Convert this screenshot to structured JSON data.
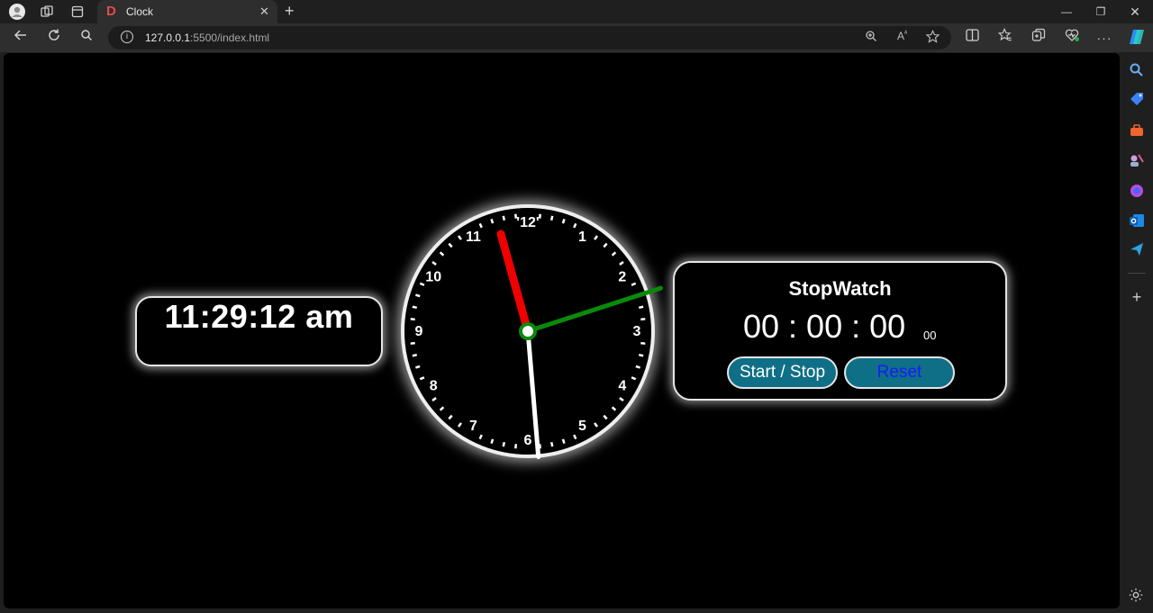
{
  "browser": {
    "tab_title": "Clock",
    "tab_favicon": "D",
    "url_host": "127.0.0.1",
    "url_path": ":5500/index.html"
  },
  "icons": {
    "profile": "avatar-icon",
    "workspaces": "workspaces-icon",
    "tab_actions": "tab-actions-icon",
    "close": "close-icon",
    "new_tab": "plus-icon",
    "back": "arrow-left-icon",
    "refresh": "refresh-icon",
    "search": "search-icon",
    "info": "info-icon",
    "zoom": "zoom-icon",
    "read_aloud": "read-aloud-icon",
    "favorite": "star-icon",
    "split": "split-screen-icon",
    "favorites": "favorites-icon",
    "collections": "collections-icon",
    "health": "browser-essentials-icon",
    "more": "more-icon",
    "copilot": "copilot-icon",
    "settings": "gear-icon"
  },
  "digital_clock": {
    "time": "11:29:12 am"
  },
  "analog_clock": {
    "numerals": [
      "'12'",
      "1",
      "2",
      "3",
      "4",
      "5",
      "6",
      "7",
      "8",
      "9",
      "10",
      "11"
    ],
    "hour": 11,
    "minute": 29,
    "second": 12,
    "hour_hand_color": "#ee0000",
    "minute_hand_color": "#ffffff",
    "second_hand_color": "#0a8a0a"
  },
  "stopwatch": {
    "title": "StopWatch",
    "display": "00 : 00 : 00",
    "milliseconds": "00",
    "start_stop_label": "Start / Stop",
    "reset_label": "Reset",
    "button_color": "#0f6f86"
  },
  "colors": {
    "page_bg": "#000000",
    "chrome_bg": "#1f1f1f",
    "toolbar_bg": "#2e2e2e"
  }
}
